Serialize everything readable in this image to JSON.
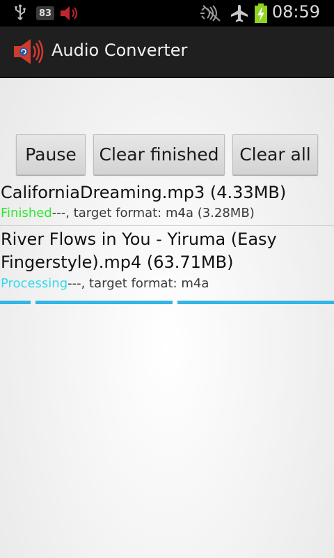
{
  "statusbar": {
    "battery_level_badge": "83",
    "time": "08:59",
    "icons": [
      "usb-icon",
      "volume-muted-icon",
      "no-signal-icon",
      "airplane-icon",
      "battery-charging-icon"
    ]
  },
  "actionbar": {
    "title": "Audio Converter",
    "icon": "speaker-app-icon"
  },
  "buttons": {
    "pause": "Pause",
    "clear_finished": "Clear finished",
    "clear_all": "Clear all"
  },
  "jobs": [
    {
      "filename": "CaliforniaDreaming.mp3 (4.33MB)",
      "status": "Finished",
      "status_color": "#2ee82e",
      "detail": "---,  target format: m4a (3.28MB)"
    },
    {
      "filename_line1": "River Flows in You - Yiruma (Easy",
      "filename_line2": "Fingerstyle).mp4 (63.71MB)",
      "status": "Processing",
      "status_color": "#33d9ee",
      "detail": "---,  target format: m4a",
      "progress_state": "indeterminate"
    }
  ],
  "colors": {
    "accent": "#33b5e5",
    "actionbar_bg": "#1f1f1f",
    "statusbar_bg": "#000000"
  }
}
